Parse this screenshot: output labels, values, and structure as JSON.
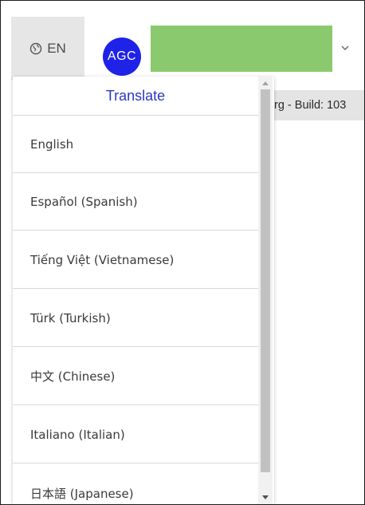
{
  "header": {
    "language_label": "EN",
    "avatar_initials": "AGC",
    "build_text": "rg - Build: 103"
  },
  "dropdown": {
    "title": "Translate",
    "items": [
      {
        "label": "English"
      },
      {
        "label": "Español (Spanish)"
      },
      {
        "label": "Tiếng Việt (Vietnamese)"
      },
      {
        "label": "Türk (Turkish)"
      },
      {
        "label": "中文 (Chinese)"
      },
      {
        "label": "Italiano (Italian)"
      },
      {
        "label": "日本語 (Japanese)"
      }
    ]
  },
  "colors": {
    "avatar_bg": "#1f23e8",
    "org_bar": "#8bc96e",
    "title_color": "#2b39c3"
  },
  "icons": {
    "language": "globe-icon",
    "account_menu": "chevron-down-icon",
    "scroll_up": "arrow-up-icon",
    "scroll_down": "arrow-down-icon"
  }
}
